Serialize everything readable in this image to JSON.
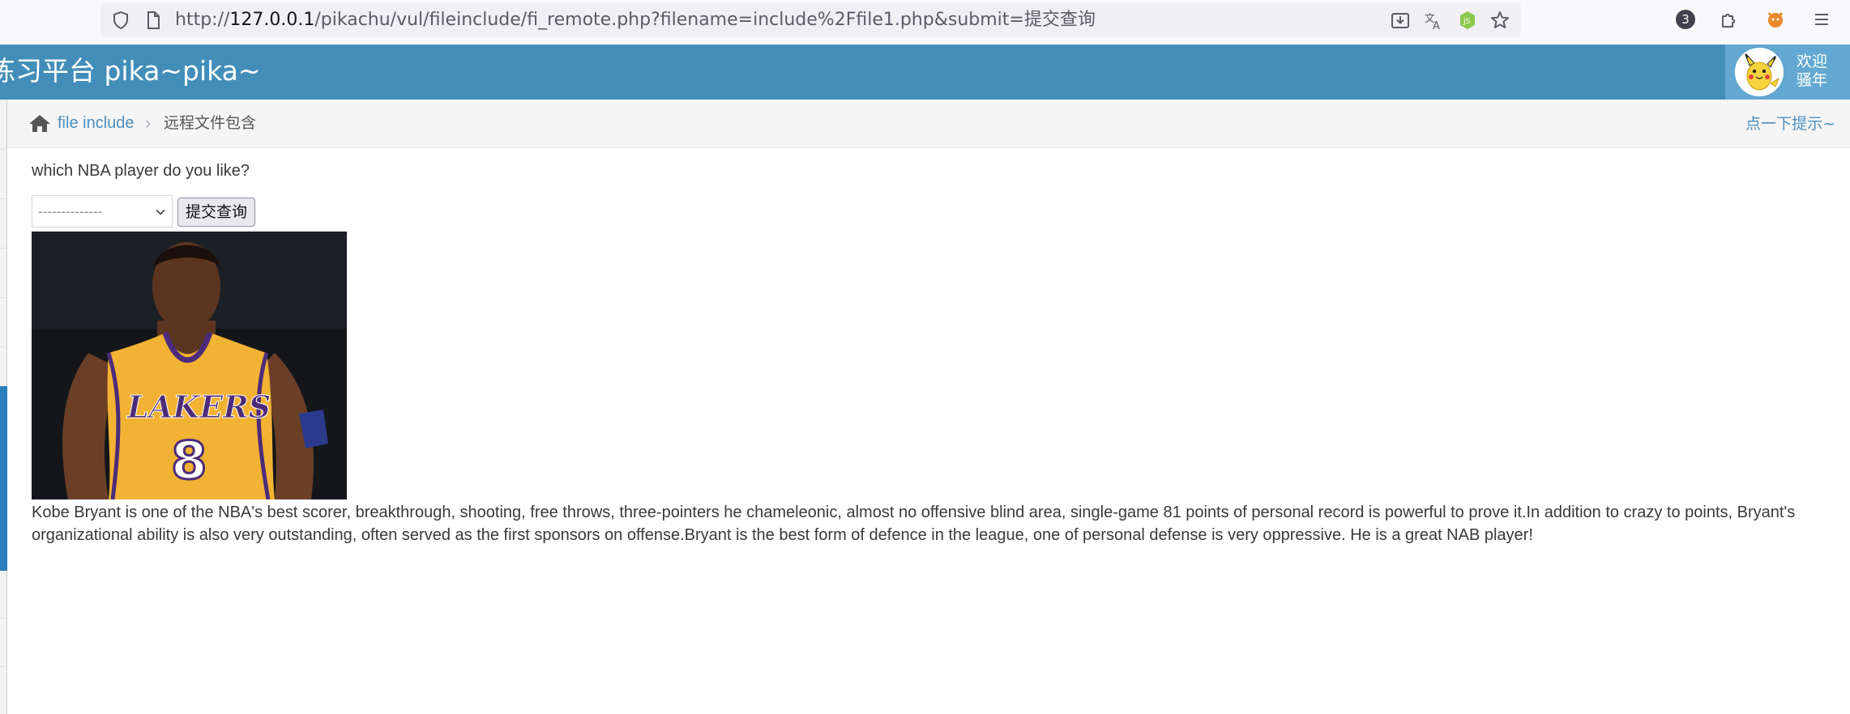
{
  "browser": {
    "url_prefix": "http://",
    "url_host": "127.0.0.1",
    "url_rest": "/pikachu/vul/fileinclude/fi_remote.php?filename=include%2Ffile1.php&submit=提交查询",
    "extensions_badge": "3",
    "icons": [
      "shield-icon",
      "page-icon",
      "save-to-device-icon",
      "translate-icon",
      "nodejs-extension-icon",
      "bookmark-star-icon",
      "extensions-puzzle-icon",
      "fox-extension-icon",
      "menu-icon"
    ]
  },
  "header": {
    "title": "练习平台 pika~pika~",
    "welcome_line1": "欢迎",
    "welcome_line2": "骚年",
    "brand_color": "#438eb9"
  },
  "breadcrumb": {
    "link": "file include",
    "separator": "›",
    "current": "远程文件包含",
    "hint": "点一下提示~"
  },
  "form": {
    "question": "which NBA player do you like?",
    "select_value": "--------------",
    "submit_label": "提交查询"
  },
  "player": {
    "jersey_text": "LAKERS",
    "jersey_number": "8",
    "description": "Kobe Bryant is one of the NBA's best scorer, breakthrough, shooting, free throws, three-pointers he chameleonic, almost no offensive blind area, single-game 81 points of personal record is powerful to prove it.In addition to crazy to points, Bryant's organizational ability is also very outstanding, often served as the first sponsors on offense.Bryant is the best form of defence in the league, one of personal defense is very oppressive. He is a great NAB player!"
  }
}
